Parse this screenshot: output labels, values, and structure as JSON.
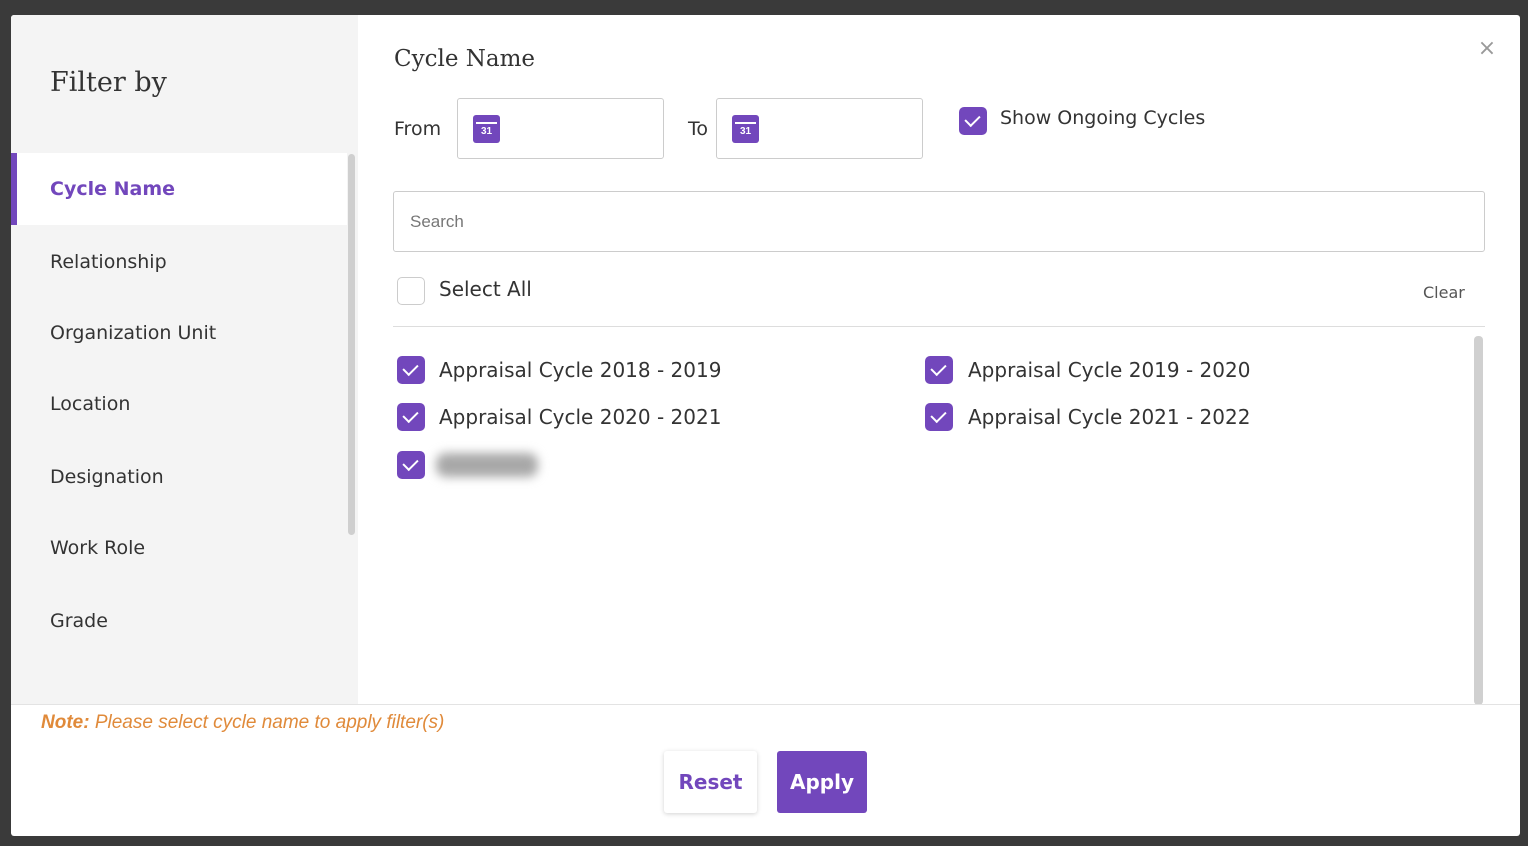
{
  "sidebar": {
    "title": "Filter by",
    "items": [
      {
        "label": "Cycle Name",
        "active": true
      },
      {
        "label": "Relationship"
      },
      {
        "label": "Organization Unit"
      },
      {
        "label": "Location"
      },
      {
        "label": "Designation"
      },
      {
        "label": "Work Role"
      },
      {
        "label": "Grade"
      }
    ]
  },
  "panel": {
    "title": "Cycle Name",
    "close_icon": "×",
    "from_label": "From",
    "to_label": "To",
    "from_value": "",
    "to_value": "",
    "show_ongoing_label": "Show Ongoing Cycles",
    "show_ongoing_checked": true,
    "search_placeholder": "Search",
    "select_all_label": "Select All",
    "select_all_checked": false,
    "clear_label": "Clear",
    "options": [
      {
        "label": "Appraisal Cycle 2018 - 2019",
        "checked": true
      },
      {
        "label": "Appraisal Cycle 2019 - 2020",
        "checked": true
      },
      {
        "label": "Appraisal Cycle 2020 - 2021",
        "checked": true
      },
      {
        "label": "Appraisal Cycle 2021 - 2022",
        "checked": true
      },
      {
        "label": "",
        "checked": true,
        "blurred": true
      }
    ]
  },
  "footer": {
    "note_prefix": "Note:",
    "note_text": " Please select cycle name to apply filter(s)",
    "reset_label": "Reset",
    "apply_label": "Apply"
  },
  "colors": {
    "accent": "#7247bc",
    "note": "#e08a3a",
    "backdrop": "#3a3a3a"
  }
}
